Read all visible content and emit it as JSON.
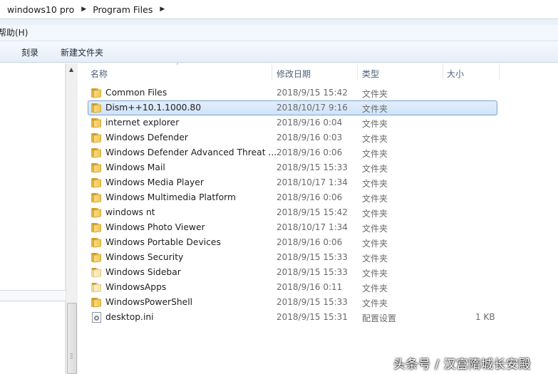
{
  "address": {
    "crumbs": [
      "windows10 pro",
      "Program Files"
    ]
  },
  "menu": {
    "help_label": "帮助(H)"
  },
  "toolbar": {
    "burn_label": "刻录",
    "new_folder_label": "新建文件夹"
  },
  "columns": {
    "name": "名称",
    "date": "修改日期",
    "type": "类型",
    "size": "大小"
  },
  "files": [
    {
      "name": "Common Files",
      "date": "2018/9/15 15:42",
      "type": "文件夹",
      "size": "",
      "icon": "folder-icon"
    },
    {
      "name": "Dism++10.1.1000.80",
      "date": "2018/10/17 9:16",
      "type": "文件夹",
      "size": "",
      "icon": "folder-icon"
    },
    {
      "name": "internet explorer",
      "date": "2018/9/16 0:04",
      "type": "文件夹",
      "size": "",
      "icon": "folder-icon"
    },
    {
      "name": "Windows Defender",
      "date": "2018/9/16 0:03",
      "type": "文件夹",
      "size": "",
      "icon": "folder-icon"
    },
    {
      "name": "Windows Defender Advanced Threat ...",
      "date": "2018/9/16 0:06",
      "type": "文件夹",
      "size": "",
      "icon": "folder-icon"
    },
    {
      "name": "Windows Mail",
      "date": "2018/9/15 15:33",
      "type": "文件夹",
      "size": "",
      "icon": "folder-icon"
    },
    {
      "name": "Windows Media Player",
      "date": "2018/10/17 1:34",
      "type": "文件夹",
      "size": "",
      "icon": "folder-icon"
    },
    {
      "name": "Windows Multimedia Platform",
      "date": "2018/9/16 0:06",
      "type": "文件夹",
      "size": "",
      "icon": "folder-icon"
    },
    {
      "name": "windows nt",
      "date": "2018/9/15 15:42",
      "type": "文件夹",
      "size": "",
      "icon": "folder-icon"
    },
    {
      "name": "Windows Photo Viewer",
      "date": "2018/10/17 1:34",
      "type": "文件夹",
      "size": "",
      "icon": "folder-icon"
    },
    {
      "name": "Windows Portable Devices",
      "date": "2018/9/16 0:06",
      "type": "文件夹",
      "size": "",
      "icon": "folder-icon"
    },
    {
      "name": "Windows Security",
      "date": "2018/9/15 15:33",
      "type": "文件夹",
      "size": "",
      "icon": "folder-icon"
    },
    {
      "name": "Windows Sidebar",
      "date": "2018/9/15 15:33",
      "type": "文件夹",
      "size": "",
      "icon": "folder-icon-faded"
    },
    {
      "name": "WindowsApps",
      "date": "2018/9/16 0:11",
      "type": "文件夹",
      "size": "",
      "icon": "folder-icon-faded"
    },
    {
      "name": "WindowsPowerShell",
      "date": "2018/9/15 15:33",
      "type": "文件夹",
      "size": "",
      "icon": "folder-icon"
    },
    {
      "name": "desktop.ini",
      "date": "2018/9/15 15:31",
      "type": "配置设置",
      "size": "1 KB",
      "icon": "settings-file-icon"
    }
  ],
  "selected_index": 1,
  "watermark": "头条号 / 汉宫隋城长安殿"
}
